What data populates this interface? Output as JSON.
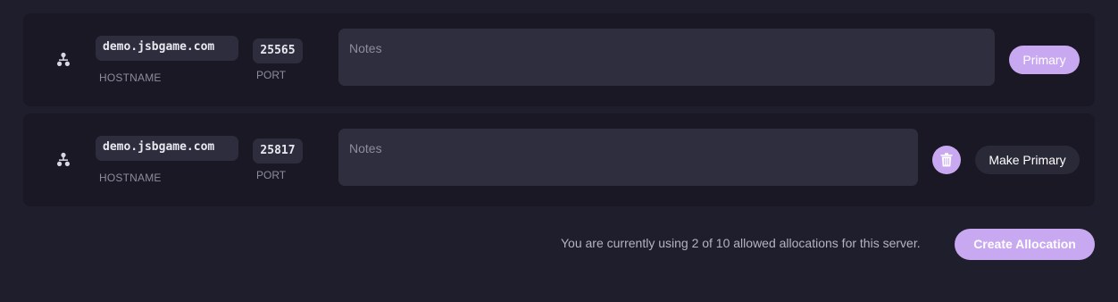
{
  "allocations": [
    {
      "hostname": "demo.jsbgame.com",
      "hostname_label": "HOSTNAME",
      "port": "25565",
      "port_label": "PORT",
      "notes_value": "",
      "notes_placeholder": "Notes",
      "status_label": "Primary",
      "icon": "network-icon"
    },
    {
      "hostname": "demo.jsbgame.com",
      "hostname_label": "HOSTNAME",
      "port": "25817",
      "port_label": "PORT",
      "notes_value": "",
      "notes_placeholder": "Notes",
      "action_label": "Make Primary",
      "delete_icon": "trash-icon",
      "icon": "network-icon"
    }
  ],
  "footer": {
    "usage_text": "You are currently using 2 of 10 allowed allocations for this server.",
    "create_label": "Create Allocation"
  },
  "colors": {
    "accent": "#c9a8f2",
    "background": "#1f1e2c",
    "card": "#191824",
    "field": "#2e2d3d"
  }
}
